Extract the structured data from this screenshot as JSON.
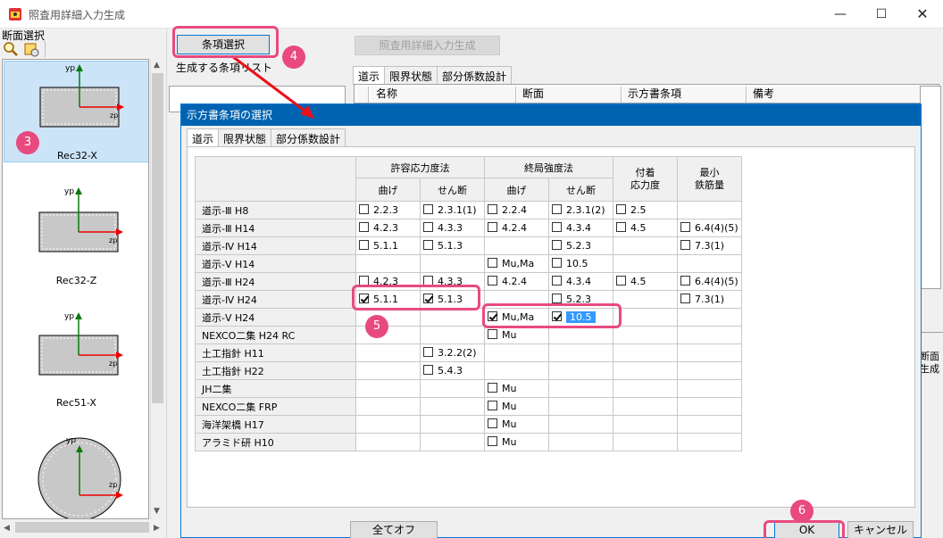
{
  "window": {
    "title": "照査用詳細入力生成",
    "minimize": "—",
    "maximize": "☐",
    "close": "✕"
  },
  "left": {
    "label": "断面選択",
    "items": [
      {
        "label": "Rec32-X",
        "selected": true
      },
      {
        "label": "Rec32-Z"
      },
      {
        "label": "Rec51-X"
      }
    ],
    "axis_y": "yp",
    "axis_z": "zp"
  },
  "toolbar": {
    "select_button": "条項選択",
    "generate_button": "照査用詳細入力生成",
    "list_label": "生成する条項リスト"
  },
  "main_tabs": [
    "道示",
    "限界状態",
    "部分係数設計"
  ],
  "main_grid_columns": [
    "名称",
    "断面",
    "示方書条項",
    "備考"
  ],
  "right_edge_text": [
    "断面",
    "生成"
  ],
  "dialog": {
    "title": "示方書条項の選択",
    "tabs": [
      "道示",
      "限界状態",
      "部分係数設計"
    ],
    "groups": {
      "allow": "許容応力度法",
      "ultimate": "終局強度法",
      "bond": "付着\n応力度",
      "min": "最小\n鉄筋量"
    },
    "subheaders": {
      "bend": "曲げ",
      "shear": "せん断"
    },
    "rows": [
      {
        "name": "道示-Ⅲ H8",
        "cells": [
          {
            "t": "2.2.3"
          },
          {
            "t": "2.3.1(1)"
          },
          {
            "t": "2.2.4"
          },
          {
            "t": "2.3.1(2)"
          },
          {
            "t": "2.5"
          },
          null
        ]
      },
      {
        "name": "道示-Ⅲ H14",
        "cells": [
          {
            "t": "4.2.3"
          },
          {
            "t": "4.3.3"
          },
          {
            "t": "4.2.4"
          },
          {
            "t": "4.3.4"
          },
          {
            "t": "4.5"
          },
          {
            "t": "6.4(4)(5)"
          }
        ]
      },
      {
        "name": "道示-Ⅳ H14",
        "cells": [
          {
            "t": "5.1.1"
          },
          {
            "t": "5.1.3"
          },
          null,
          {
            "t": "5.2.3"
          },
          null,
          {
            "t": "7.3(1)"
          }
        ]
      },
      {
        "name": "道示-Ⅴ H14",
        "cells": [
          null,
          null,
          {
            "t": "Mu,Ma"
          },
          {
            "t": "10.5"
          },
          null,
          null
        ]
      },
      {
        "name": "道示-Ⅲ H24",
        "cells": [
          {
            "t": "4.2.3"
          },
          {
            "t": "4.3.3"
          },
          {
            "t": "4.2.4"
          },
          {
            "t": "4.3.4"
          },
          {
            "t": "4.5"
          },
          {
            "t": "6.4(4)(5)"
          }
        ]
      },
      {
        "name": "道示-Ⅳ H24",
        "cells": [
          {
            "t": "5.1.1",
            "c": true
          },
          {
            "t": "5.1.3",
            "c": true
          },
          null,
          {
            "t": "5.2.3"
          },
          null,
          {
            "t": "7.3(1)"
          }
        ]
      },
      {
        "name": "道示-Ⅴ H24",
        "cells": [
          null,
          null,
          {
            "t": "Mu,Ma",
            "c": true
          },
          {
            "t": "10.5",
            "c": true,
            "h": true
          },
          null,
          null
        ]
      },
      {
        "name": "NEXCO二集 H24 RC",
        "cells": [
          null,
          null,
          {
            "t": "Mu"
          },
          null,
          null,
          null
        ]
      },
      {
        "name": "土工指針 H11",
        "cells": [
          null,
          {
            "t": "3.2.2(2)"
          },
          null,
          null,
          null,
          null
        ]
      },
      {
        "name": "土工指針 H22",
        "cells": [
          null,
          {
            "t": "5.4.3"
          },
          null,
          null,
          null,
          null
        ]
      },
      {
        "name": "JH二集",
        "cells": [
          null,
          null,
          {
            "t": "Mu"
          },
          null,
          null,
          null
        ]
      },
      {
        "name": "NEXCO二集 FRP",
        "cells": [
          null,
          null,
          {
            "t": "Mu"
          },
          null,
          null,
          null
        ]
      },
      {
        "name": "海洋架橋 H17",
        "cells": [
          null,
          null,
          {
            "t": "Mu"
          },
          null,
          null,
          null
        ]
      },
      {
        "name": "アラミド研 H10",
        "cells": [
          null,
          null,
          {
            "t": "Mu"
          },
          null,
          null,
          null
        ]
      }
    ],
    "buttons": {
      "all_off": "全てオフ",
      "ok": "OK",
      "cancel": "キャンセル"
    }
  },
  "annotations": [
    "3",
    "4",
    "5",
    "6"
  ],
  "colors": {
    "accent": "#e84a7f",
    "selection": "#cce4f7",
    "titlebar": "#0063b1",
    "highlight": "#3399ff"
  }
}
